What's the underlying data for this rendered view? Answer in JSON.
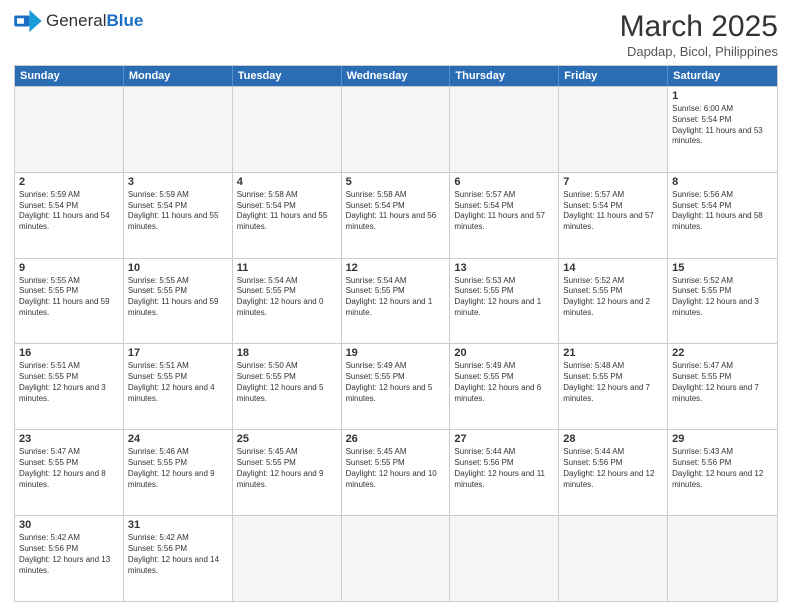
{
  "logo": {
    "text_general": "General",
    "text_blue": "Blue"
  },
  "title": "March 2025",
  "subtitle": "Dapdap, Bicol, Philippines",
  "weekdays": [
    "Sunday",
    "Monday",
    "Tuesday",
    "Wednesday",
    "Thursday",
    "Friday",
    "Saturday"
  ],
  "rows": [
    [
      {
        "day": "",
        "empty": true
      },
      {
        "day": "",
        "empty": true
      },
      {
        "day": "",
        "empty": true
      },
      {
        "day": "",
        "empty": true
      },
      {
        "day": "",
        "empty": true
      },
      {
        "day": "",
        "empty": true
      },
      {
        "day": "1",
        "sunrise": "6:00 AM",
        "sunset": "5:54 PM",
        "daylight": "11 hours and 53 minutes."
      }
    ],
    [
      {
        "day": "2",
        "sunrise": "5:59 AM",
        "sunset": "5:54 PM",
        "daylight": "11 hours and 54 minutes."
      },
      {
        "day": "3",
        "sunrise": "5:59 AM",
        "sunset": "5:54 PM",
        "daylight": "11 hours and 55 minutes."
      },
      {
        "day": "4",
        "sunrise": "5:58 AM",
        "sunset": "5:54 PM",
        "daylight": "11 hours and 55 minutes."
      },
      {
        "day": "5",
        "sunrise": "5:58 AM",
        "sunset": "5:54 PM",
        "daylight": "11 hours and 56 minutes."
      },
      {
        "day": "6",
        "sunrise": "5:57 AM",
        "sunset": "5:54 PM",
        "daylight": "11 hours and 57 minutes."
      },
      {
        "day": "7",
        "sunrise": "5:57 AM",
        "sunset": "5:54 PM",
        "daylight": "11 hours and 57 minutes."
      },
      {
        "day": "8",
        "sunrise": "5:56 AM",
        "sunset": "5:54 PM",
        "daylight": "11 hours and 58 minutes."
      }
    ],
    [
      {
        "day": "9",
        "sunrise": "5:55 AM",
        "sunset": "5:55 PM",
        "daylight": "11 hours and 59 minutes."
      },
      {
        "day": "10",
        "sunrise": "5:55 AM",
        "sunset": "5:55 PM",
        "daylight": "11 hours and 59 minutes."
      },
      {
        "day": "11",
        "sunrise": "5:54 AM",
        "sunset": "5:55 PM",
        "daylight": "12 hours and 0 minutes."
      },
      {
        "day": "12",
        "sunrise": "5:54 AM",
        "sunset": "5:55 PM",
        "daylight": "12 hours and 1 minute."
      },
      {
        "day": "13",
        "sunrise": "5:53 AM",
        "sunset": "5:55 PM",
        "daylight": "12 hours and 1 minute."
      },
      {
        "day": "14",
        "sunrise": "5:52 AM",
        "sunset": "5:55 PM",
        "daylight": "12 hours and 2 minutes."
      },
      {
        "day": "15",
        "sunrise": "5:52 AM",
        "sunset": "5:55 PM",
        "daylight": "12 hours and 3 minutes."
      }
    ],
    [
      {
        "day": "16",
        "sunrise": "5:51 AM",
        "sunset": "5:55 PM",
        "daylight": "12 hours and 3 minutes."
      },
      {
        "day": "17",
        "sunrise": "5:51 AM",
        "sunset": "5:55 PM",
        "daylight": "12 hours and 4 minutes."
      },
      {
        "day": "18",
        "sunrise": "5:50 AM",
        "sunset": "5:55 PM",
        "daylight": "12 hours and 5 minutes."
      },
      {
        "day": "19",
        "sunrise": "5:49 AM",
        "sunset": "5:55 PM",
        "daylight": "12 hours and 5 minutes."
      },
      {
        "day": "20",
        "sunrise": "5:49 AM",
        "sunset": "5:55 PM",
        "daylight": "12 hours and 6 minutes."
      },
      {
        "day": "21",
        "sunrise": "5:48 AM",
        "sunset": "5:55 PM",
        "daylight": "12 hours and 7 minutes."
      },
      {
        "day": "22",
        "sunrise": "5:47 AM",
        "sunset": "5:55 PM",
        "daylight": "12 hours and 7 minutes."
      }
    ],
    [
      {
        "day": "23",
        "sunrise": "5:47 AM",
        "sunset": "5:55 PM",
        "daylight": "12 hours and 8 minutes."
      },
      {
        "day": "24",
        "sunrise": "5:46 AM",
        "sunset": "5:55 PM",
        "daylight": "12 hours and 9 minutes."
      },
      {
        "day": "25",
        "sunrise": "5:45 AM",
        "sunset": "5:55 PM",
        "daylight": "12 hours and 9 minutes."
      },
      {
        "day": "26",
        "sunrise": "5:45 AM",
        "sunset": "5:55 PM",
        "daylight": "12 hours and 10 minutes."
      },
      {
        "day": "27",
        "sunrise": "5:44 AM",
        "sunset": "5:56 PM",
        "daylight": "12 hours and 11 minutes."
      },
      {
        "day": "28",
        "sunrise": "5:44 AM",
        "sunset": "5:56 PM",
        "daylight": "12 hours and 12 minutes."
      },
      {
        "day": "29",
        "sunrise": "5:43 AM",
        "sunset": "5:56 PM",
        "daylight": "12 hours and 12 minutes."
      }
    ],
    [
      {
        "day": "30",
        "sunrise": "5:42 AM",
        "sunset": "5:56 PM",
        "daylight": "12 hours and 13 minutes."
      },
      {
        "day": "31",
        "sunrise": "5:42 AM",
        "sunset": "5:56 PM",
        "daylight": "12 hours and 14 minutes."
      },
      {
        "day": "",
        "empty": true
      },
      {
        "day": "",
        "empty": true
      },
      {
        "day": "",
        "empty": true
      },
      {
        "day": "",
        "empty": true
      },
      {
        "day": "",
        "empty": true
      }
    ]
  ]
}
